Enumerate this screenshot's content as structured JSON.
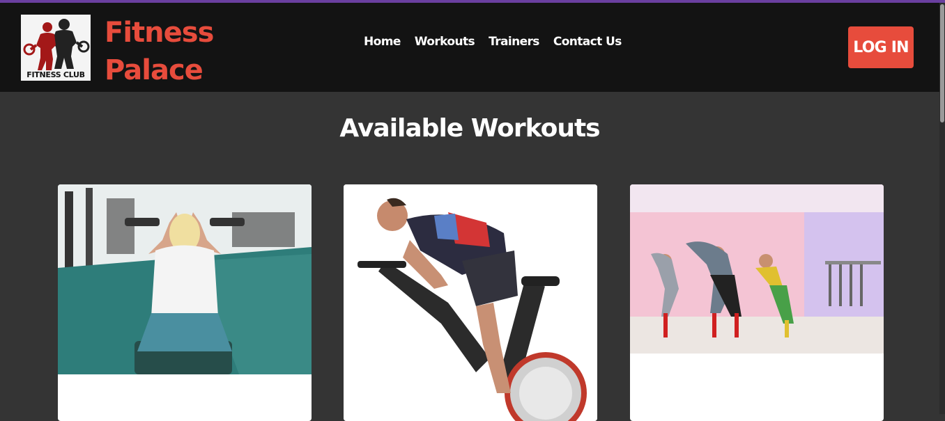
{
  "navbar": {
    "logo_caption": "FITNESS CLUB",
    "brand_line1": "Fitness",
    "brand_line2": "Palace",
    "links": [
      {
        "label": "Home"
      },
      {
        "label": "Workouts"
      },
      {
        "label": "Trainers"
      },
      {
        "label": "Contact Us"
      }
    ],
    "login_label": "LOG IN"
  },
  "main": {
    "title": "Available Workouts",
    "cards": [
      {
        "image": "weightlifting-photo"
      },
      {
        "image": "cycling-photo"
      },
      {
        "image": "dance-class-photo"
      }
    ]
  },
  "colors": {
    "accent": "#e74c3c",
    "navbar_bg": "#131313",
    "page_bg": "#343434",
    "top_line": "#6a3fa0"
  }
}
